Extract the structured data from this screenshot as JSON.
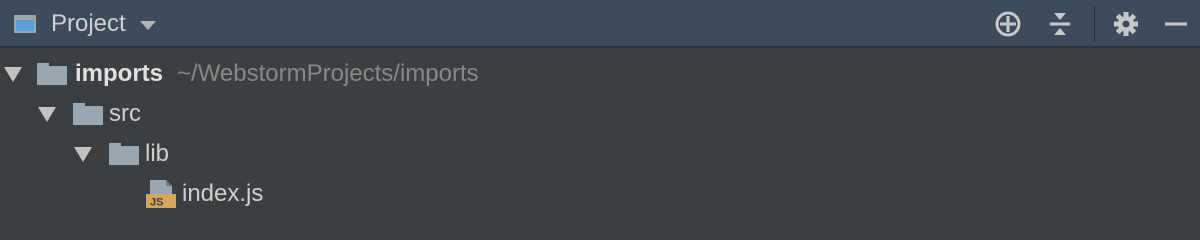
{
  "header": {
    "title": "Project",
    "icons": [
      "project-view-icon",
      "dropdown-caret-icon",
      "locate-target-icon",
      "collapse-all-icon",
      "gear-icon",
      "hide-minus-icon"
    ]
  },
  "tree": {
    "root": {
      "name": "imports",
      "path": "~/WebstormProjects/imports",
      "expanded": true
    },
    "src": {
      "name": "src",
      "expanded": true
    },
    "lib": {
      "name": "lib",
      "expanded": true
    },
    "file": {
      "name": "index.js",
      "badge": "JS"
    }
  },
  "colors": {
    "header_bg": "#3d4b5c",
    "panel_bg": "#3c3f41",
    "folder": "#9aa7b0",
    "js_badge": "#d8a657"
  }
}
